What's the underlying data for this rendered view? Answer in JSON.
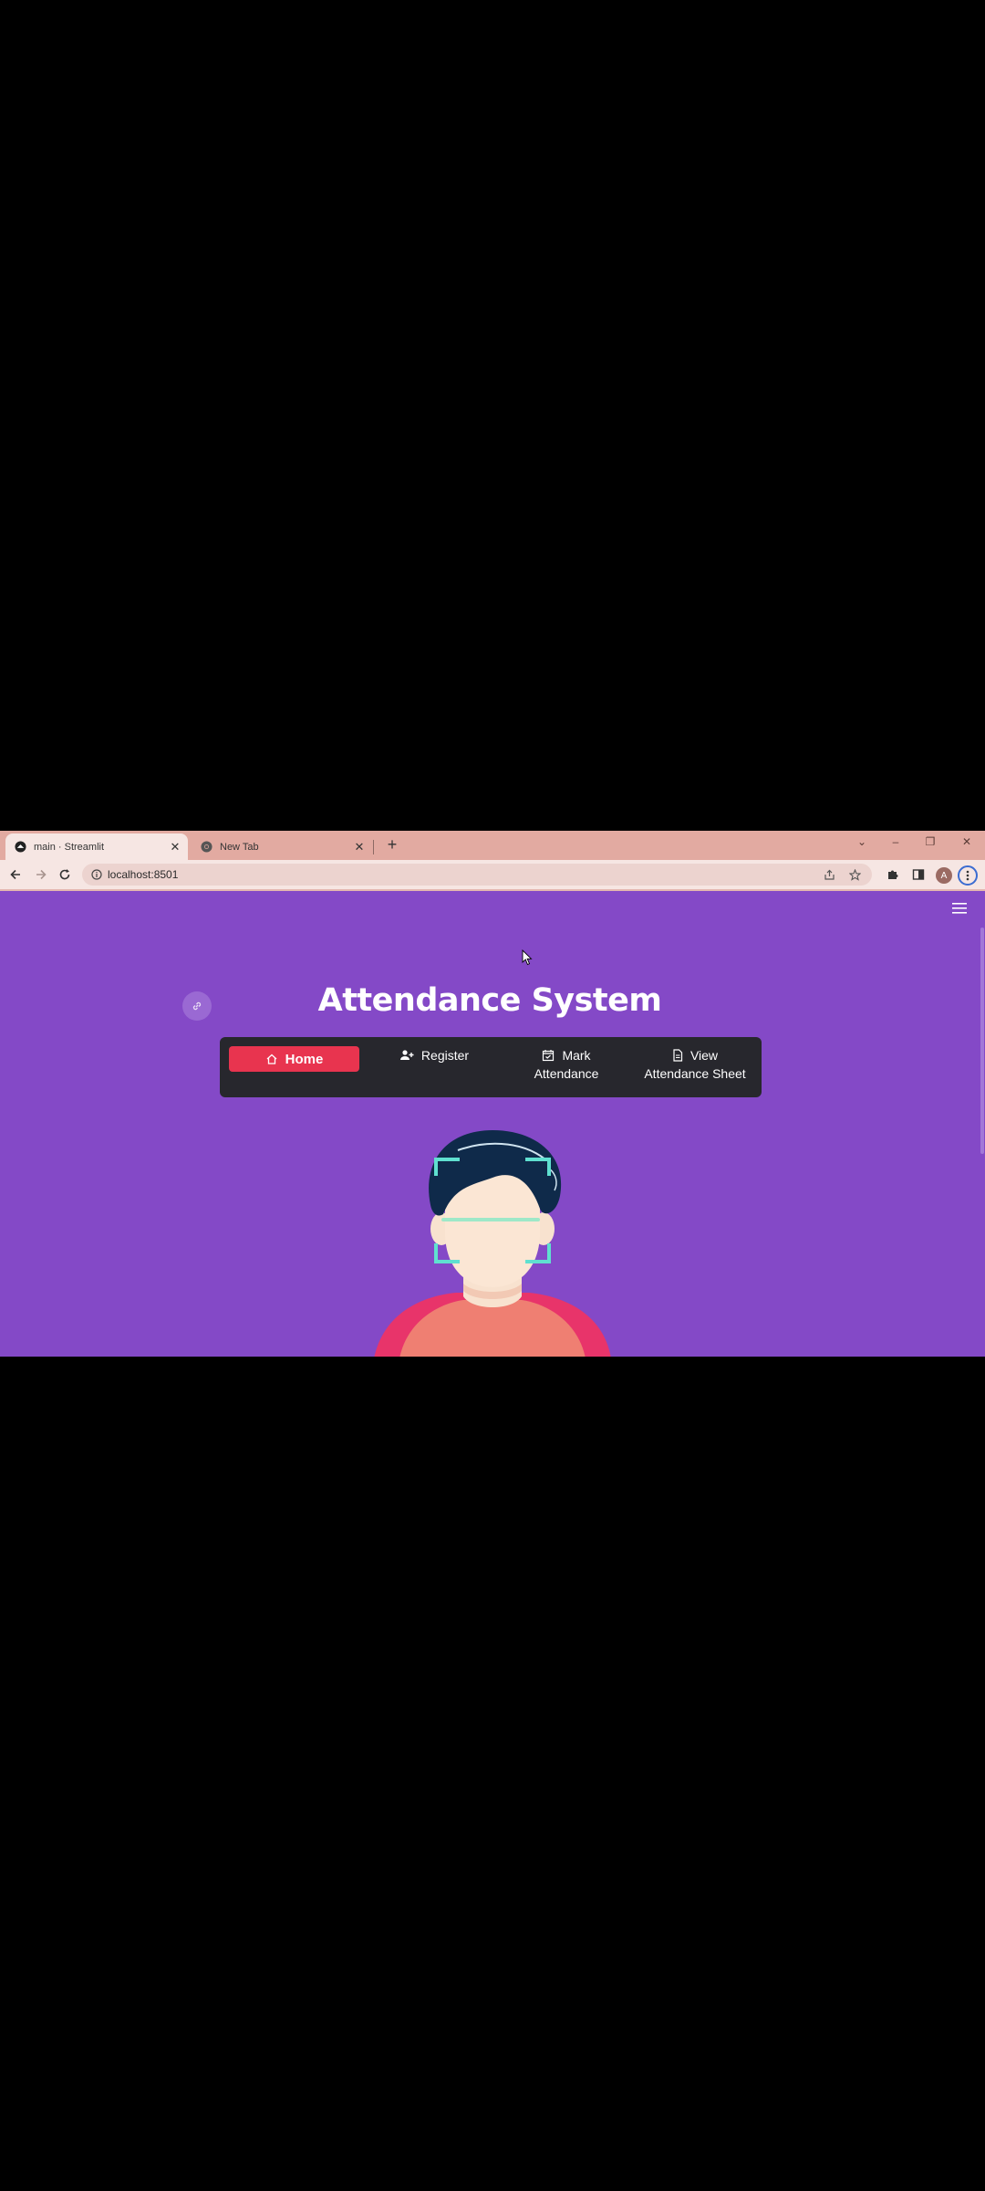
{
  "browser": {
    "tabs": [
      {
        "title": "main · Streamlit",
        "active": true,
        "favicon": "streamlit-favicon"
      },
      {
        "title": "New Tab",
        "active": false,
        "favicon": "chrome-favicon"
      }
    ],
    "address_bar": {
      "url": "localhost:8501"
    },
    "profile_initial": "A"
  },
  "app": {
    "title": "Attendance System",
    "nav": {
      "home": {
        "label": "Home",
        "icon": "house-icon"
      },
      "register": {
        "label": "Register",
        "icon": "person-plus-icon"
      },
      "mark": {
        "line1": "Mark",
        "line2": "Attendance",
        "icon": "calendar-check-icon"
      },
      "view": {
        "line1": "View",
        "line2": "Attendance Sheet",
        "icon": "file-icon"
      }
    },
    "colors": {
      "background": "#8449c7",
      "nav_bg": "#27272d",
      "nav_active": "#e8344f",
      "tab_strip": "#e2aaa1"
    }
  }
}
